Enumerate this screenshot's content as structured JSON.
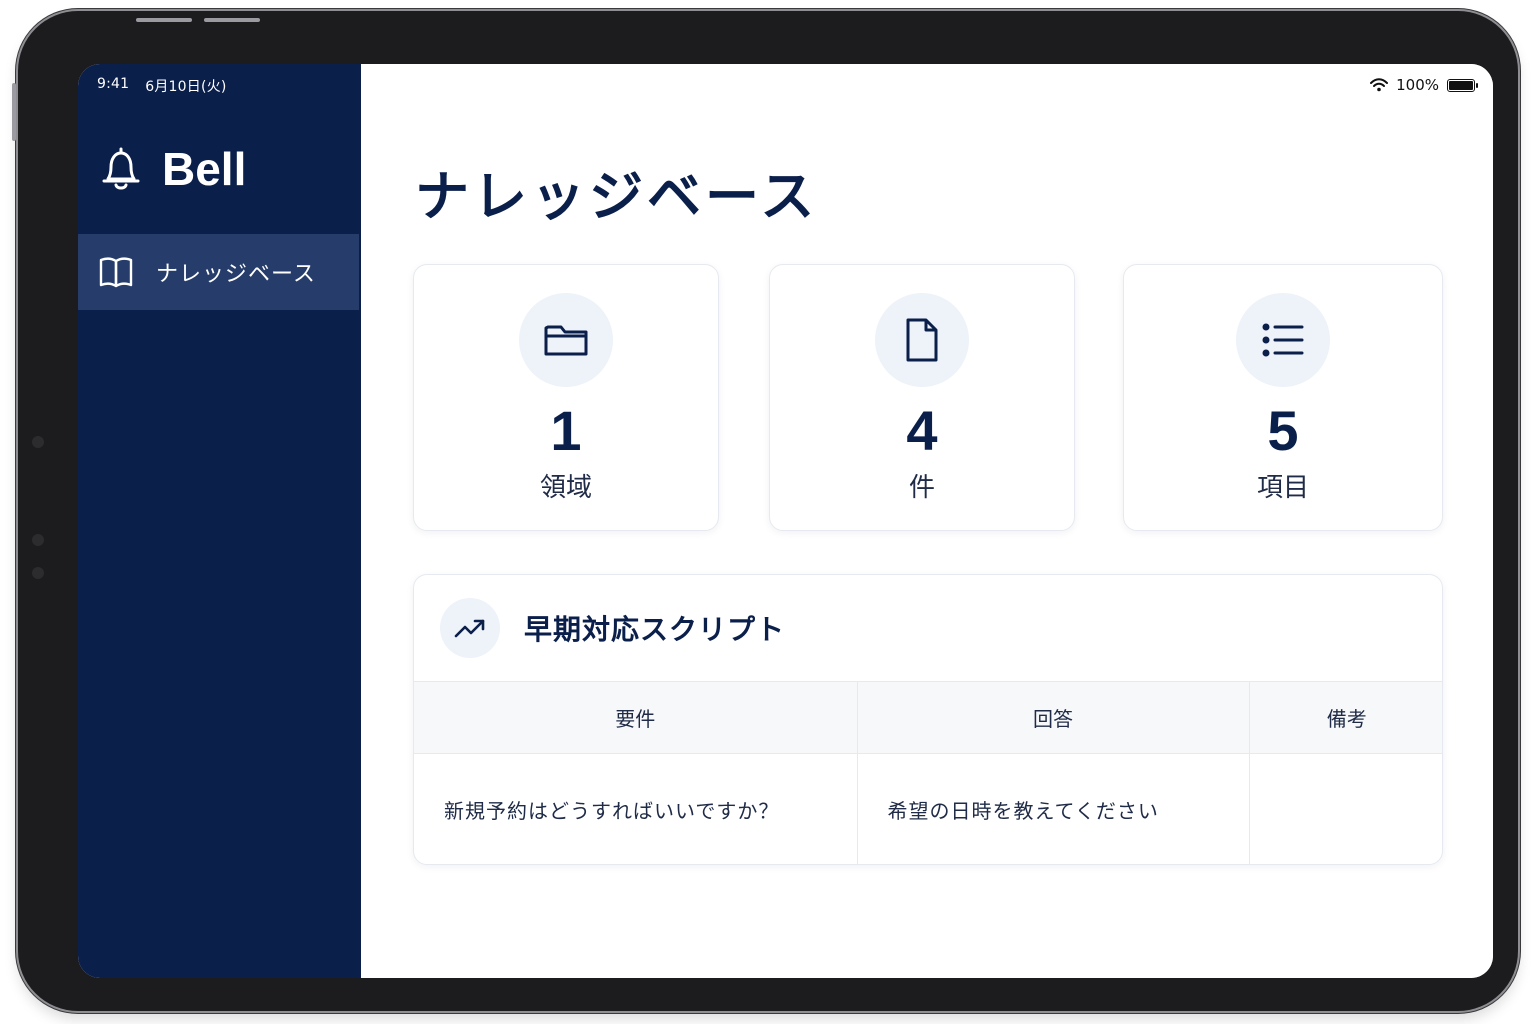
{
  "status_bar": {
    "time": "9:41",
    "date": "6月10日(火)",
    "battery": "100%"
  },
  "sidebar": {
    "brand": "Bell",
    "items": [
      {
        "label": "ナレッジベース",
        "icon": "book-open-icon",
        "active": true
      }
    ]
  },
  "main": {
    "title": "ナレッジベース",
    "stats": [
      {
        "value": "1",
        "label": "領域",
        "icon": "folder-icon"
      },
      {
        "value": "4",
        "label": "件",
        "icon": "file-icon"
      },
      {
        "value": "5",
        "label": "項目",
        "icon": "list-icon"
      }
    ],
    "script": {
      "title": "早期対応スクリプト",
      "icon": "trending-up-icon",
      "columns": [
        "要件",
        "回答",
        "備考"
      ],
      "rows": [
        [
          "新規予約はどうすればいいですか？",
          "希望の日時を教えてください",
          ""
        ]
      ]
    }
  },
  "colors": {
    "sidebar_bg": "#0b1f4b",
    "sidebar_active": "#263d6b",
    "accent": "#0b1f4b",
    "icon_circle": "#eef2f9"
  }
}
